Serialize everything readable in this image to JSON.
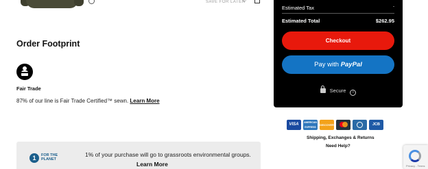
{
  "cart": {
    "save_hint": "SAVE FOR LATER"
  },
  "footprint": {
    "title": "Order Footprint",
    "badge_label": "Fair Trade",
    "description": "87% of our line is Fair Trade Certified™ sewn.",
    "learn_more": "Learn More"
  },
  "planet": {
    "logo_number": "1",
    "logo_text_line1": "FOR THE",
    "logo_text_line2": "PLANET",
    "text": "1% of your purchase will go to grassroots environmental groups.",
    "learn_more": "Learn More"
  },
  "summary": {
    "tax_label": "Estimated Tax",
    "tax_value": "-",
    "total_label": "Estimated Total",
    "total_value": "$262.95",
    "checkout_label": "Checkout",
    "paypal_prefix": "Pay with",
    "paypal_brand": "PayPal",
    "secure_label": "Secure",
    "info_glyph": "i",
    "accent_checkout": "#e8190c",
    "accent_paypal": "#1474c4"
  },
  "payments": {
    "visa": "VISA",
    "amex": "AMERICAN EXPRESS",
    "discover": "DISCOVER",
    "jcb": "JCB"
  },
  "links": {
    "shipping": "Shipping, Exchanges & Returns",
    "help": "Need Help?"
  },
  "recaptcha": {
    "label": "Privacy - Terms"
  }
}
